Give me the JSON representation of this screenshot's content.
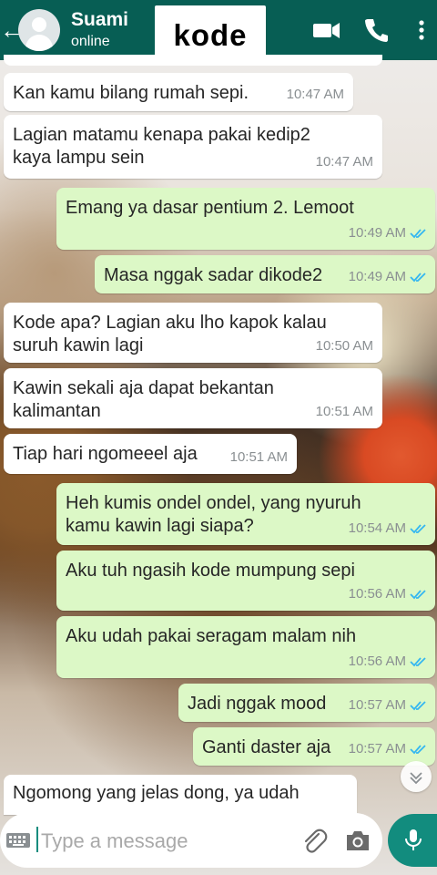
{
  "header": {
    "contact_name": "Suami",
    "status": "online",
    "label": "kode"
  },
  "messages": [
    {
      "dir": "in",
      "text": "Kan kamu bilang rumah sepi.",
      "time": "10:47 AM"
    },
    {
      "dir": "in",
      "text": "Lagian matamu kenapa pakai kedip2\nkaya lampu sein",
      "time": "10:47 AM"
    },
    {
      "dir": "out",
      "text": "Emang ya dasar pentium 2. Lemoot",
      "time": "10:49 AM",
      "status": "read"
    },
    {
      "dir": "out",
      "text": "Masa nggak sadar dikode2",
      "time": "10:49 AM",
      "status": "read"
    },
    {
      "dir": "in",
      "text": "Kode apa? Lagian aku lho kapok kalau\nsuruh kawin lagi",
      "time": "10:50 AM"
    },
    {
      "dir": "in",
      "text": "Kawin sekali aja dapat bekantan\nkalimantan",
      "time": "10:51 AM"
    },
    {
      "dir": "in",
      "text": "Tiap hari ngomeeel aja",
      "time": "10:51 AM"
    },
    {
      "dir": "out",
      "text": "Heh kumis ondel ondel, yang nyuruh\nkamu kawin lagi siapa?",
      "time": "10:54 AM",
      "status": "read"
    },
    {
      "dir": "out",
      "text": "Aku tuh ngasih kode mumpung sepi",
      "time": "10:56 AM",
      "status": "read"
    },
    {
      "dir": "out",
      "text": "Aku udah pakai seragam malam nih",
      "time": "10:56 AM",
      "status": "read"
    },
    {
      "dir": "out",
      "text": "Jadi nggak mood",
      "time": "10:57 AM",
      "status": "read"
    },
    {
      "dir": "out",
      "text": "Ganti daster aja",
      "time": "10:57 AM",
      "status": "read"
    },
    {
      "dir": "in",
      "text": "Ngomong yang jelas dong, ya udah",
      "time": ""
    }
  ],
  "input": {
    "placeholder": "Type a message"
  },
  "colors": {
    "header": "#075e54",
    "incoming": "#ffffff",
    "outgoing": "#dcf8c6",
    "tick_read": "#34b7f1",
    "accent": "#128c7e"
  },
  "icons": [
    "back-arrow-icon",
    "video-call-icon",
    "phone-icon",
    "more-menu-icon",
    "keyboard-icon",
    "attach-icon",
    "camera-icon",
    "mic-icon",
    "chevron-down-icon"
  ]
}
